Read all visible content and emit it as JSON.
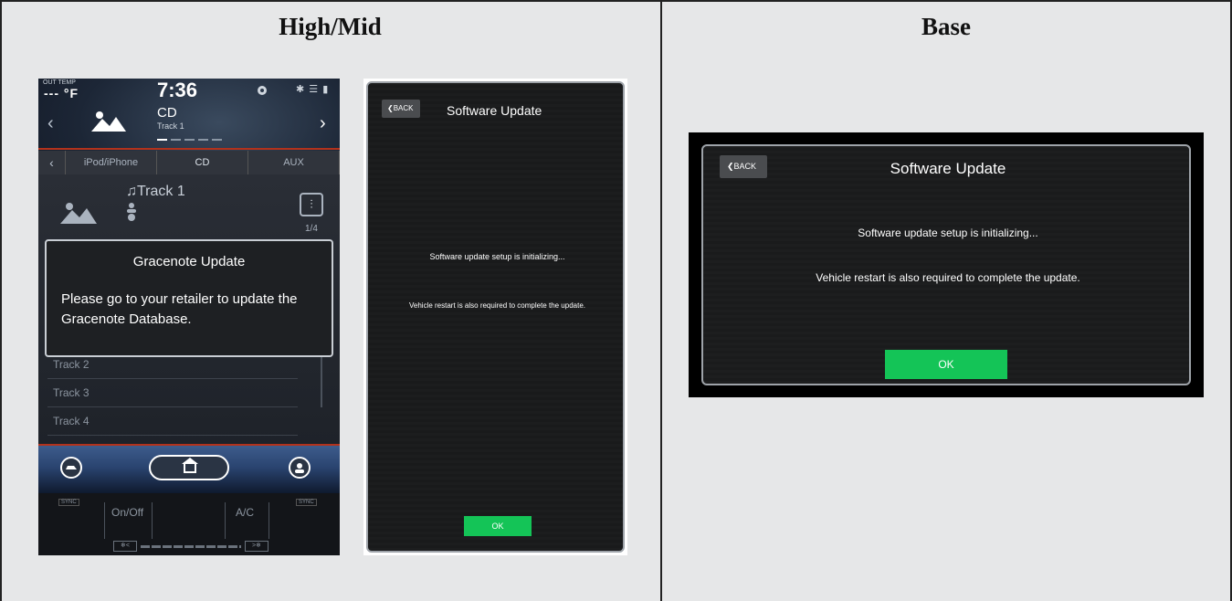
{
  "columns": {
    "left_title": "High/Mid",
    "right_title": "Base"
  },
  "audio_screen": {
    "status": {
      "out_temp_label": "OUT TEMP",
      "out_temp_value": "--- °F",
      "clock": "7:36",
      "bt_signal": "✱ ☰ ▮"
    },
    "source": {
      "title": "CD",
      "subtitle": "Track 1",
      "prev_arrow": "‹",
      "next_arrow": "›"
    },
    "tabs": [
      {
        "label": "iPod/iPhone"
      },
      {
        "label": "CD"
      },
      {
        "label": "AUX"
      }
    ],
    "tab_arrow": "‹",
    "now_playing": {
      "track": "♫Track 1",
      "count": "1/4",
      "eq_glyph": "⫶"
    },
    "track_list": [
      "Track 2",
      "Track 3",
      "Track 4"
    ],
    "dialog": {
      "title": "Gracenote Update",
      "body": "Please go to your retailer to update the Gracenote Database."
    },
    "climate": {
      "sync_left": "SYNC",
      "sync_right": "SYNC",
      "onoff": "On/Off",
      "ac": "A/C",
      "fan_down": "❄<",
      "fan_up": ">❄"
    }
  },
  "portrait_update": {
    "back_label": "BACK",
    "title": "Software Update",
    "message1": "Software update setup is initializing...",
    "message2": "Vehicle restart is also required to complete the update.",
    "ok_label": "OK"
  },
  "landscape_update": {
    "back_label": "BACK",
    "title": "Software Update",
    "message1": "Software update setup is initializing...",
    "message2": "Vehicle restart is also required to complete the update.",
    "ok_label": "OK"
  },
  "colors": {
    "ok_green": "#14c457",
    "accent_red": "#b3321c",
    "panel_bg": "#e6e7e8"
  }
}
